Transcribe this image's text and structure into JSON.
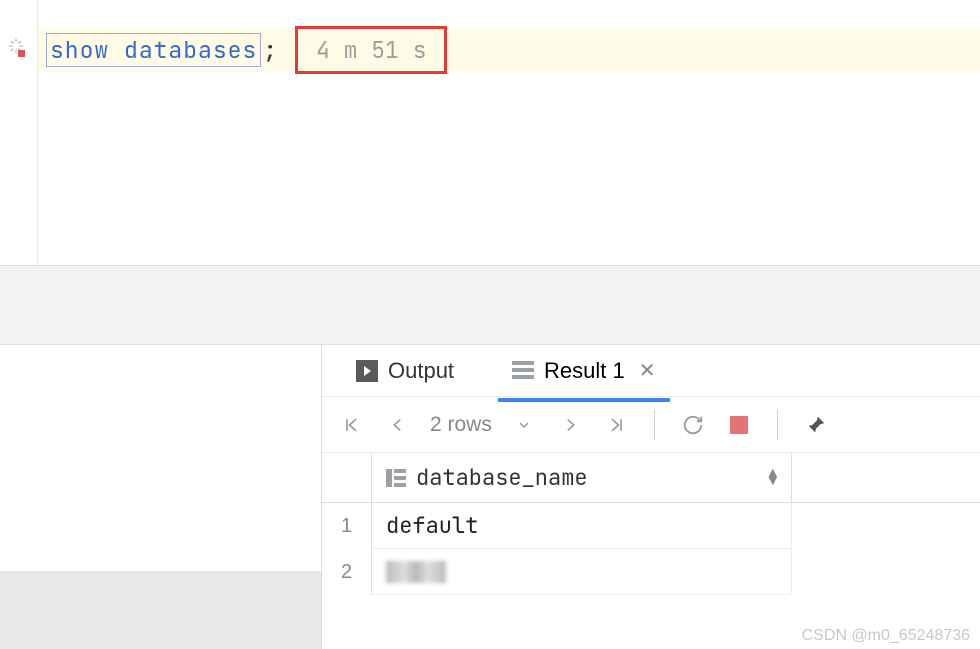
{
  "editor": {
    "sql_keyword": "show",
    "sql_identifier": "databases",
    "semicolon": ";",
    "timer": "4 m 51 s"
  },
  "tabs": {
    "output_label": "Output",
    "result_label": "Result 1"
  },
  "toolbar": {
    "rows_label": "2 rows"
  },
  "table": {
    "column_header": "database_name",
    "rows": [
      {
        "num": "1",
        "value": "default"
      },
      {
        "num": "2",
        "value": ""
      }
    ]
  },
  "watermark": "CSDN @m0_65248736"
}
